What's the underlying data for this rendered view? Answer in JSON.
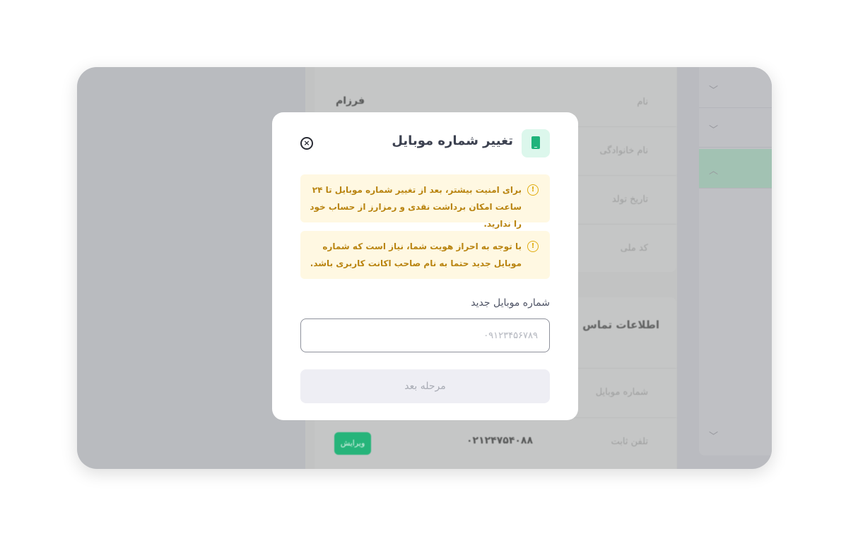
{
  "background": {
    "personal_rows": [
      {
        "label": "نام",
        "value": "فرزام"
      },
      {
        "label": "نام خانوادگی",
        "value": ""
      },
      {
        "label": "تاریخ تولد",
        "value": ""
      },
      {
        "label": "کد ملی",
        "value": ""
      }
    ],
    "contact_title": "اطلاعات تماس",
    "contact_rows": [
      {
        "label": "شماره موبایل",
        "value": "",
        "badge": ""
      },
      {
        "label": "تلفن ثابت",
        "value": "۰۲۱۲۴۷۵۴۰۸۸",
        "badge": "ویرایش"
      }
    ]
  },
  "modal": {
    "title": "تغییر شماره موبایل",
    "icon": "phone-icon",
    "alerts": [
      {
        "icon": "warning-icon",
        "text": "برای امنیت بیشتر، بعد از تغییر شماره موبایل تا ۲۴ ساعت امکان برداشت نقدی و رمزارز از حساب خود را ندارید."
      },
      {
        "icon": "warning-icon",
        "text": "با توجه به احراز هویت شما، نیاز است که شماره موبایل جدید حتما به نام صاحب اکانت کاربری باشد."
      }
    ],
    "field": {
      "label": "شماره موبایل جدید",
      "placeholder": "۰۹۱۲۳۴۵۶۷۸۹",
      "value": ""
    },
    "submit_label": "مرحله بعد"
  },
  "colors": {
    "accent": "#1fb37b",
    "warning": "#e0ac10",
    "warning_bg": "#fff8e2"
  }
}
